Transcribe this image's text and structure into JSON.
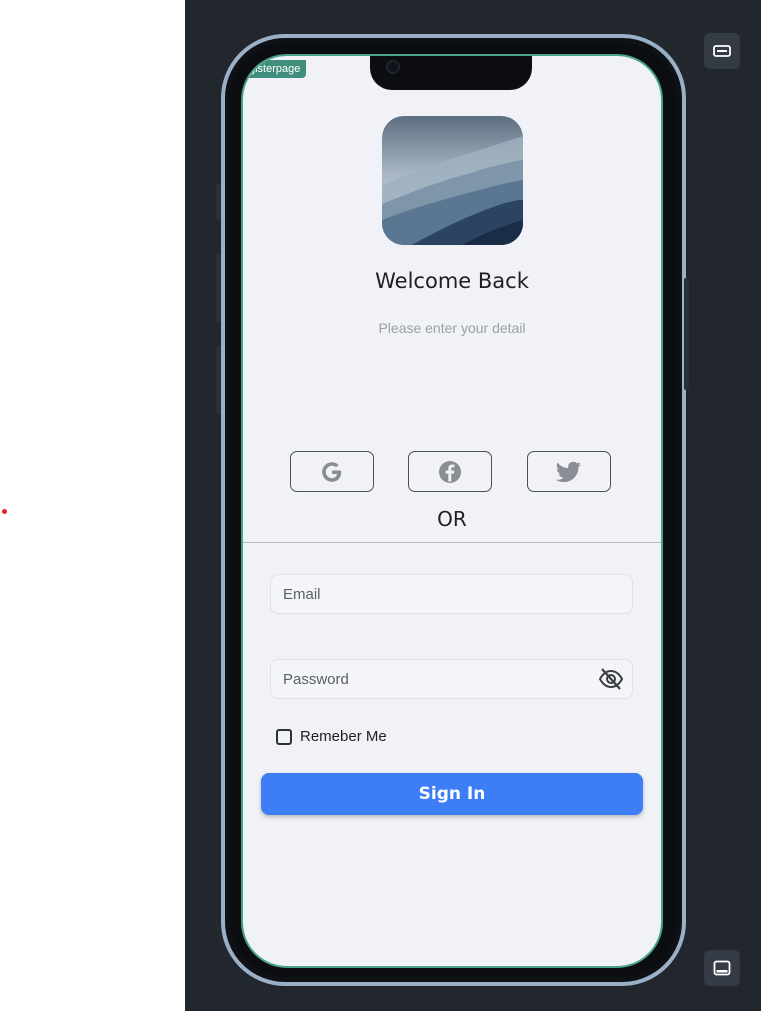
{
  "page": {
    "badge": "gisterpage",
    "title": "Welcome  Back",
    "subtitle": "Please  enter  your detail",
    "or_label": "OR"
  },
  "social": [
    {
      "name": "google",
      "icon": "google-icon"
    },
    {
      "name": "facebook",
      "icon": "facebook-icon"
    },
    {
      "name": "twitter",
      "icon": "twitter-icon"
    }
  ],
  "form": {
    "email_placeholder": "Email",
    "password_placeholder": "Password",
    "remember_label": "Remeber Me",
    "signin_label": "Sign In"
  },
  "colors": {
    "primary": "#3d7ef6",
    "screen_bg": "#f1f2f7",
    "dark_panel": "#22272e",
    "badge": "#3f8f7c",
    "phone_frame": "#9ab0c6"
  }
}
